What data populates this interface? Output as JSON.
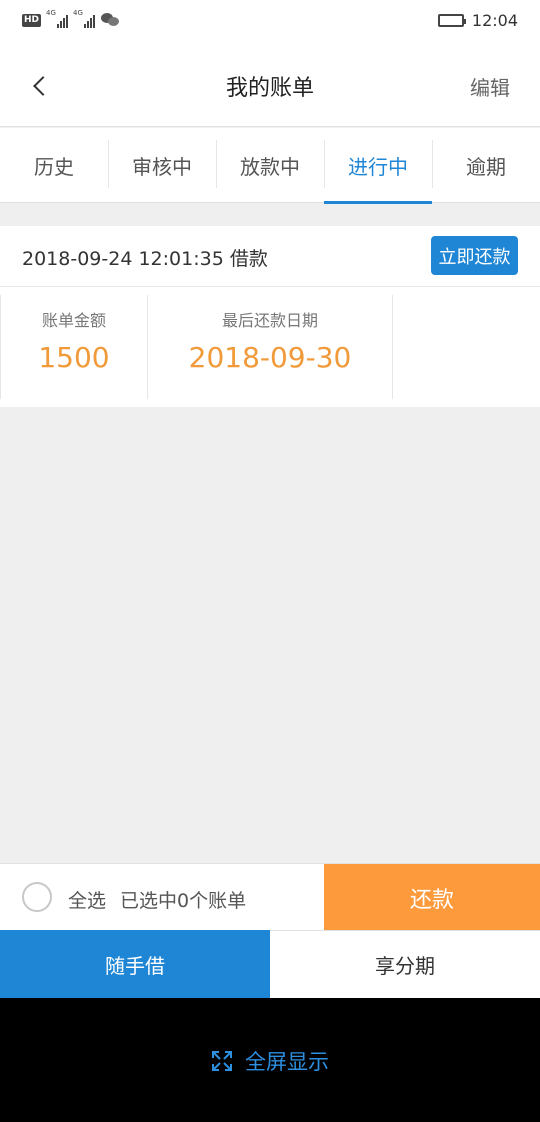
{
  "status_bar": {
    "badge": "HD",
    "network_1": "4G",
    "network_2": "4G",
    "time": "12:04",
    "icons": [
      "signal-icon",
      "signal-icon",
      "wechat-icon",
      "battery-icon"
    ]
  },
  "nav": {
    "title": "我的账单",
    "edit_label": "编辑",
    "back_icon": "chevron-left-icon"
  },
  "tabs": [
    {
      "label": "历史",
      "active": false
    },
    {
      "label": "审核中",
      "active": false
    },
    {
      "label": "放款中",
      "active": false
    },
    {
      "label": "进行中",
      "active": true
    },
    {
      "label": "逾期",
      "active": false
    }
  ],
  "bill": {
    "time_label": "2018-09-24 12:01:35 借款",
    "repay_now_label": "立即还款",
    "amount_label": "账单金额",
    "amount_value": "1500",
    "due_label": "最后还款日期",
    "due_value": "2018-09-30"
  },
  "action_row": {
    "select_all_label": "全选",
    "selected_count_label": "已选中0个账单",
    "repay_label": "还款"
  },
  "bottom_tabs": [
    {
      "label": "随手借",
      "active": true
    },
    {
      "label": "享分期",
      "active": false
    }
  ],
  "fullscreen": {
    "label": "全屏显示",
    "icon": "expand-icon"
  },
  "colors": {
    "primary": "#1f86d6",
    "accent_orange": "#fd9a3c",
    "value_orange": "#f09a3a"
  }
}
